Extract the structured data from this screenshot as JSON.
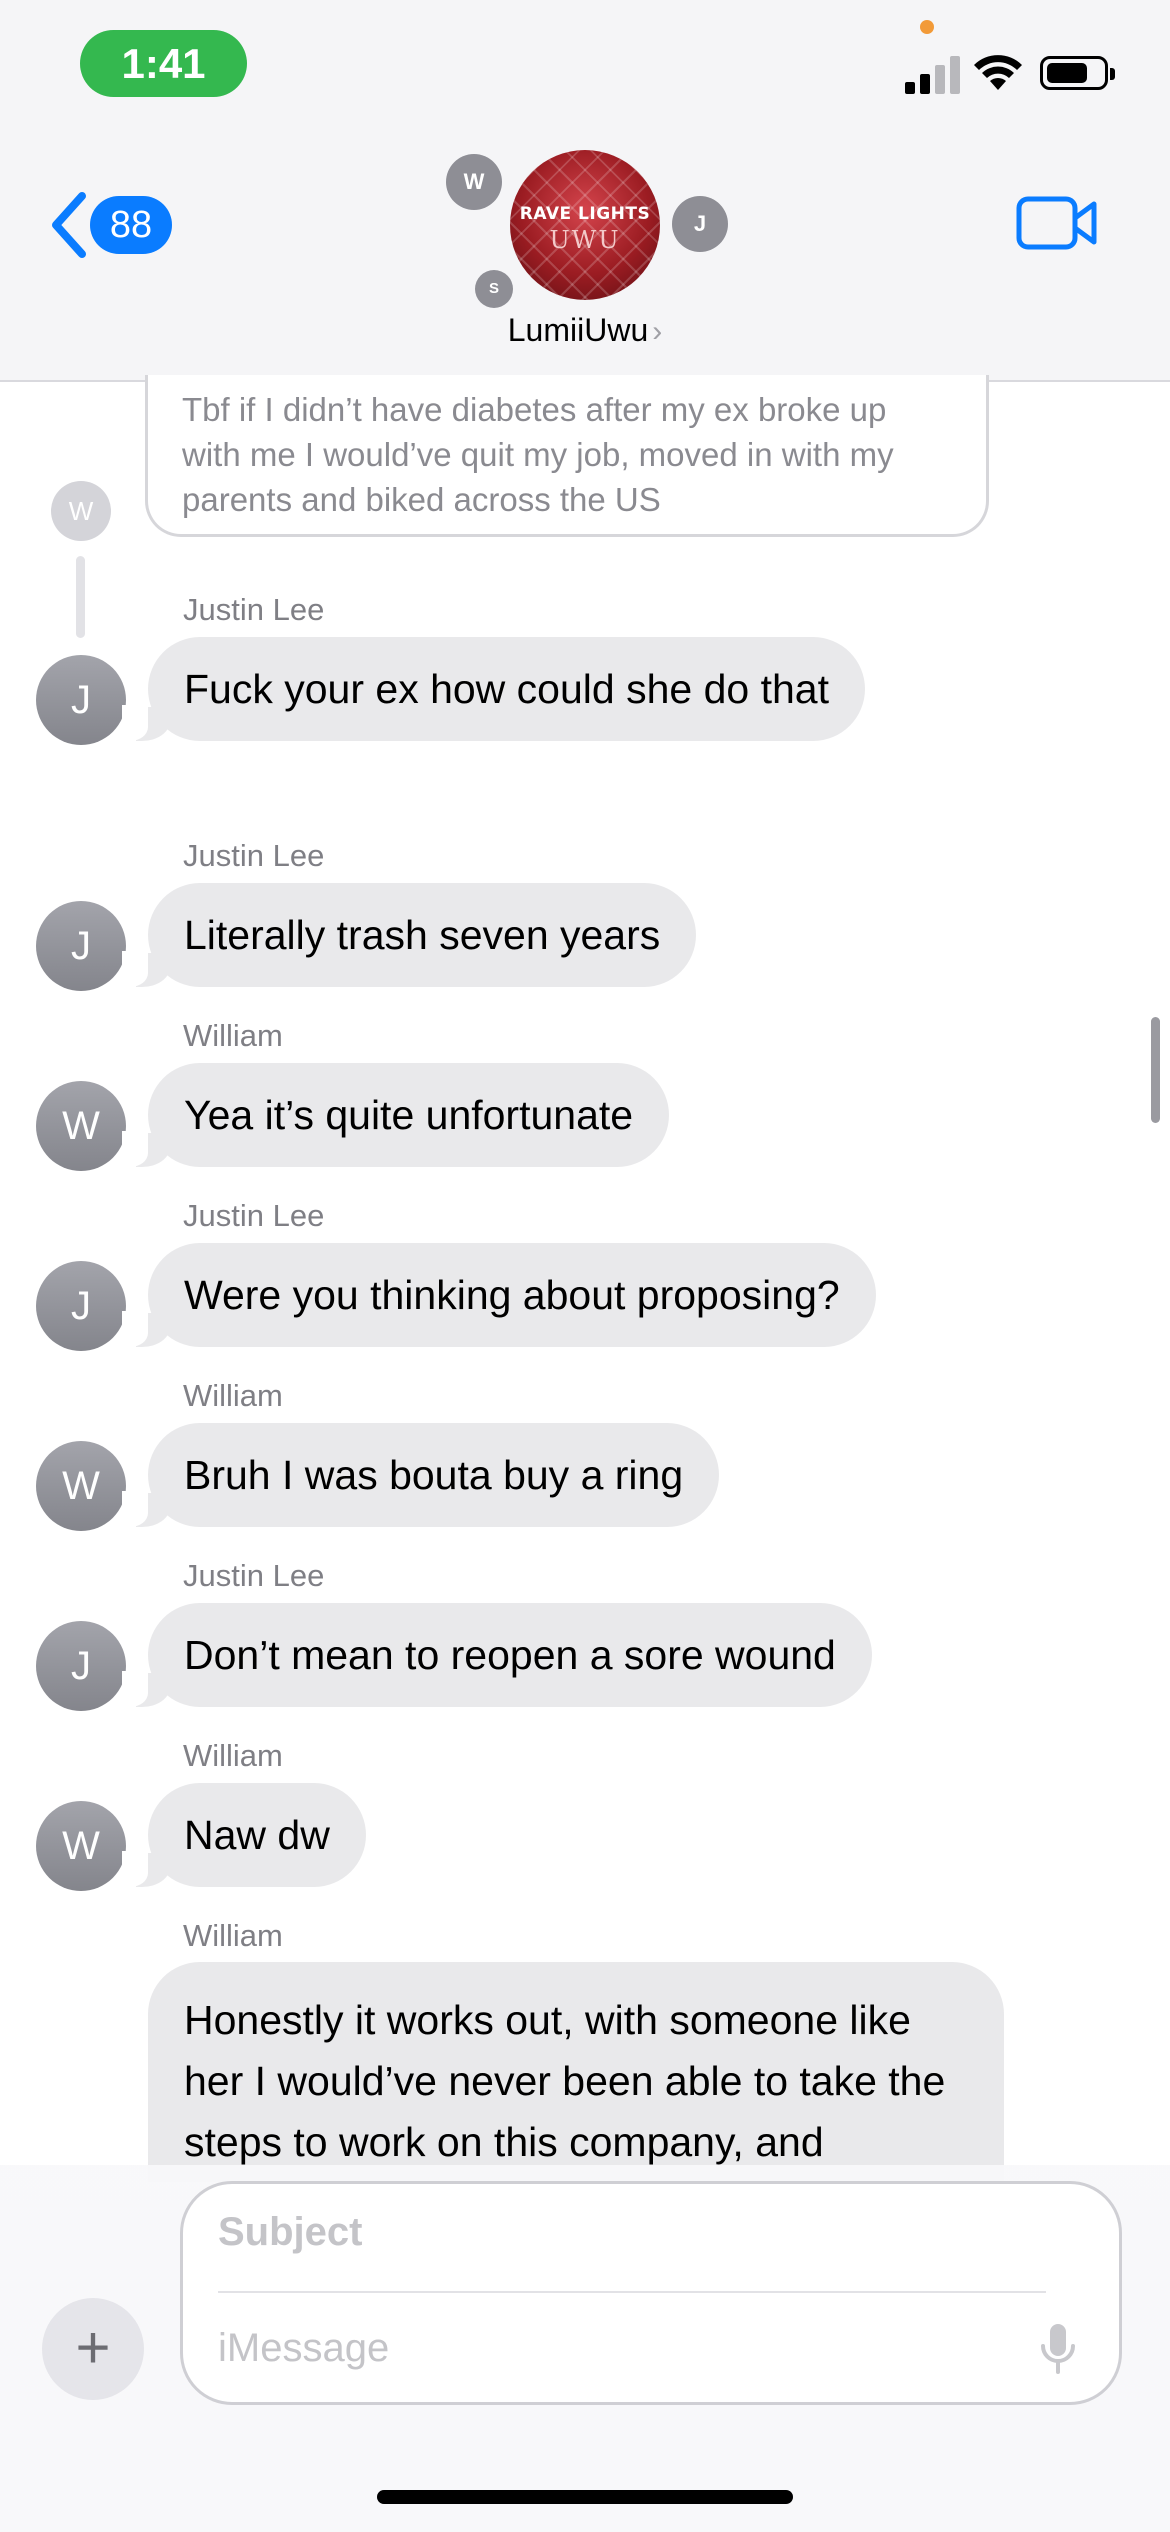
{
  "status_bar": {
    "time": "1:41"
  },
  "header": {
    "back_count": "88",
    "group_avatar_logo_line1": "RAVE LIGHTS",
    "group_avatar_logo_line2": "UWU",
    "group_name": "LumiiUwu",
    "member_initials": [
      "W",
      "J",
      "S"
    ]
  },
  "reply_context": {
    "text": "Tbf if I didn’t have diabetes after my ex broke up with me I would’ve quit my job, moved in with my parents and biked across the US",
    "avatar_initial": "W"
  },
  "messages": [
    {
      "sender": "Justin Lee",
      "initial": "J",
      "text": "Fuck your ex how could she do that"
    },
    {
      "sender": "Justin Lee",
      "initial": "J",
      "text": "Literally trash seven years"
    },
    {
      "sender": "William",
      "initial": "W",
      "text": "Yea it’s quite unfortunate"
    },
    {
      "sender": "Justin Lee",
      "initial": "J",
      "text": "Were you thinking about proposing?"
    },
    {
      "sender": "William",
      "initial": "W",
      "text": "Bruh I was bouta buy a ring"
    },
    {
      "sender": "Justin Lee",
      "initial": "J",
      "text": "Don’t mean to reopen a sore wound"
    },
    {
      "sender": "William",
      "initial": "W",
      "text": "Naw dw"
    },
    {
      "sender": "William",
      "initial": "W",
      "text": "Honestly it works out, with someone like her I would’ve never been able to take the steps to work on this company, and"
    }
  ],
  "composer": {
    "subject_placeholder": "Subject",
    "message_placeholder": "iMessage"
  },
  "colors": {
    "accent": "#0a7cff",
    "time_pill": "#34b84f",
    "bubble_gray": "#e9e9eb"
  }
}
